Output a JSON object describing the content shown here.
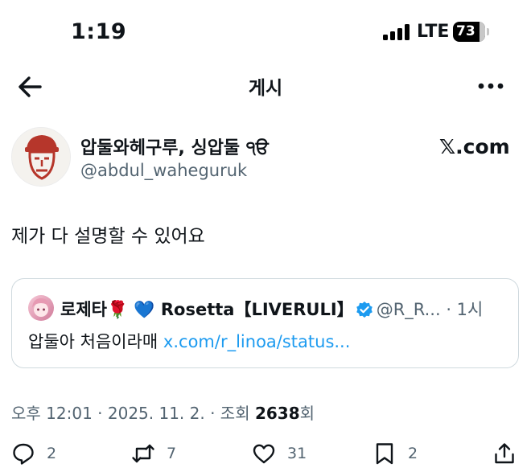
{
  "status_bar": {
    "time": "1:19",
    "network": "LTE",
    "battery": "73"
  },
  "header": {
    "title": "게시"
  },
  "post": {
    "author_name": "압둘와헤구루, 싱압둘 ੧ੳ",
    "author_handle": "@abdul_waheguruk",
    "source_logo_text": "𝕏.com",
    "text": "제가 다 설명할 수 있어요",
    "quote": {
      "display_name": "로제타🌹 💙 Rosetta【LIVERULI】",
      "handle_time": "@R_R... · 1시",
      "text": "압둘아 처음이라매 ",
      "link": "x.com/r_linoa/status..."
    },
    "meta": {
      "datetime": "오후 12:01 · 2025. 11. 2. · 조회 ",
      "views": "2638",
      "views_suffix": "회"
    },
    "actions": {
      "replies": "2",
      "reposts": "7",
      "likes": "31",
      "bookmarks": "2"
    }
  },
  "icons": [
    "back-arrow-icon",
    "more-icon",
    "verified-icon",
    "reply-icon",
    "repost-icon",
    "like-icon",
    "bookmark-icon",
    "share-icon"
  ],
  "colors": {
    "link": "#1d9bf0",
    "secondary_text": "#536471",
    "border": "#cfd9de",
    "verified": "#1d9bf0",
    "avatar_red": "#b6362b"
  }
}
